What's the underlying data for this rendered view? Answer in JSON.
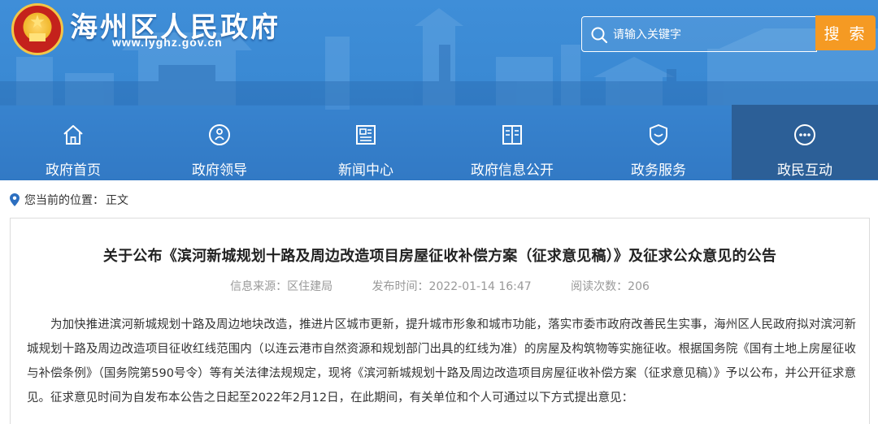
{
  "header": {
    "site_title": "海州区人民政府",
    "site_url": "www.lyghz.gov.cn",
    "search_placeholder": "请输入关键字",
    "search_button": "搜 索"
  },
  "nav": {
    "items": [
      {
        "label": "政府首页",
        "icon": "home-icon"
      },
      {
        "label": "政府领导",
        "icon": "leader-icon"
      },
      {
        "label": "新闻中心",
        "icon": "news-icon"
      },
      {
        "label": "政府信息公开",
        "icon": "book-icon"
      },
      {
        "label": "政务服务",
        "icon": "shield-icon"
      },
      {
        "label": "政民互动",
        "icon": "chat-icon"
      }
    ],
    "active_index": 5
  },
  "breadcrumb": {
    "prefix": "您当前的位置：",
    "current": "正文"
  },
  "article": {
    "title": "关于公布《滨河新城规划十路及周边改造项目房屋征收补偿方案（征求意见稿）》及征求公众意见的公告",
    "source": "信息来源：区住建局",
    "publish_time": "发布时间：2022-01-14 16:47",
    "views": "阅读次数：206",
    "body": "为加快推进滨河新城规划十路及周边地块改造，推进片区城市更新，提升城市形象和城市功能，落实市委市政府改善民生实事，海州区人民政府拟对滨河新城规划十路及周边改造项目征收红线范围内（以连云港市自然资源和规划部门出具的红线为准）的房屋及构筑物等实施征收。根据国务院《国有土地上房屋征收与补偿条例》（国务院第590号令）等有关法律法规规定，现将《滨河新城规划十路及周边改造项目房屋征收补偿方案（征求意见稿）》予以公布，并公开征求意见。征求意见时间为自发布本公告之日起至2022年2月12日，在此期间，有关单位和个人可通过以下方式提出意见："
  },
  "colors": {
    "header_blue": "#3a89d3",
    "nav_active": "#2c5f97",
    "search_button": "#f59a23",
    "meta_gray": "#999999"
  }
}
